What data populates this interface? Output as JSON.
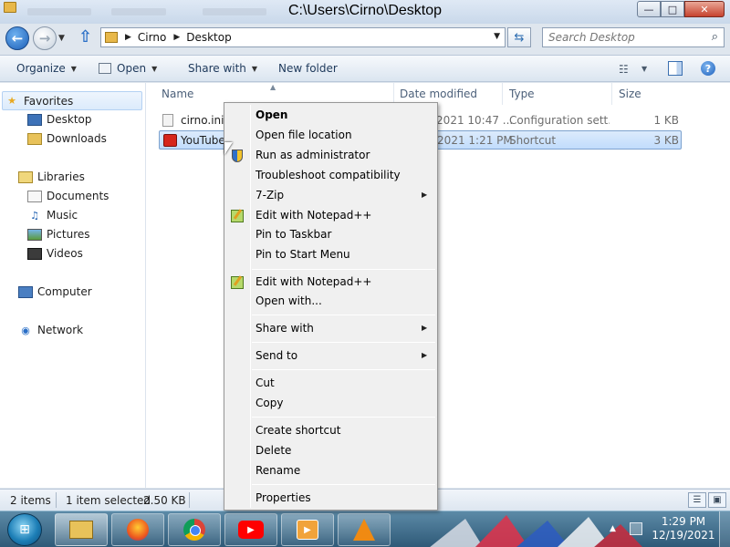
{
  "window": {
    "title": "C:\\Users\\Cirno\\Desktop",
    "buttons": {
      "minimize": "—",
      "maximize": "□",
      "close": "✕"
    }
  },
  "address": {
    "crumbs": [
      "Cirno",
      "Desktop"
    ],
    "search_placeholder": "Search Desktop"
  },
  "toolbar": {
    "organize": "Organize",
    "open": "Open",
    "share_with": "Share with",
    "new_folder": "New folder"
  },
  "nav": {
    "favorites": "Favorites",
    "favorites_items": [
      "Desktop",
      "Downloads"
    ],
    "libraries": "Libraries",
    "libraries_items": [
      "Documents",
      "Music",
      "Pictures",
      "Videos"
    ],
    "computer": "Computer",
    "network": "Network"
  },
  "file_list": {
    "columns": [
      "Name",
      "Date modified",
      "Type",
      "Size"
    ],
    "rows": [
      {
        "name": "cirno.ini",
        "date": "/2021 10:47 ...",
        "type": "Configuration sett...",
        "size": "1 KB",
        "selected": false
      },
      {
        "name": "YouTube",
        "date": "/2021 1:21 PM",
        "type": "Shortcut",
        "size": "3 KB",
        "selected": true
      }
    ]
  },
  "context_menu": {
    "items": [
      "Open",
      "Open file location",
      "Run as administrator",
      "Troubleshoot compatibility",
      "7-Zip",
      "Edit with Notepad++",
      "Pin to Taskbar",
      "Pin to Start Menu",
      "Edit with Notepad++",
      "Open with...",
      "Share with",
      "Send to",
      "Cut",
      "Copy",
      "Create shortcut",
      "Delete",
      "Rename",
      "Properties"
    ]
  },
  "status": {
    "count": "2 items",
    "selection": "1 item selected",
    "size": "2.50 KB"
  },
  "taskbar": {
    "apps": [
      "explorer-icon",
      "firefox-icon",
      "chrome-icon",
      "youtube-icon",
      "media-player-icon",
      "vlc-icon"
    ],
    "time": "1:29 PM",
    "date": "12/19/2021"
  },
  "colors": {
    "selection": "#c1dcfc",
    "taskbar": "#2f5a78",
    "accent": "#1c5fb8"
  }
}
